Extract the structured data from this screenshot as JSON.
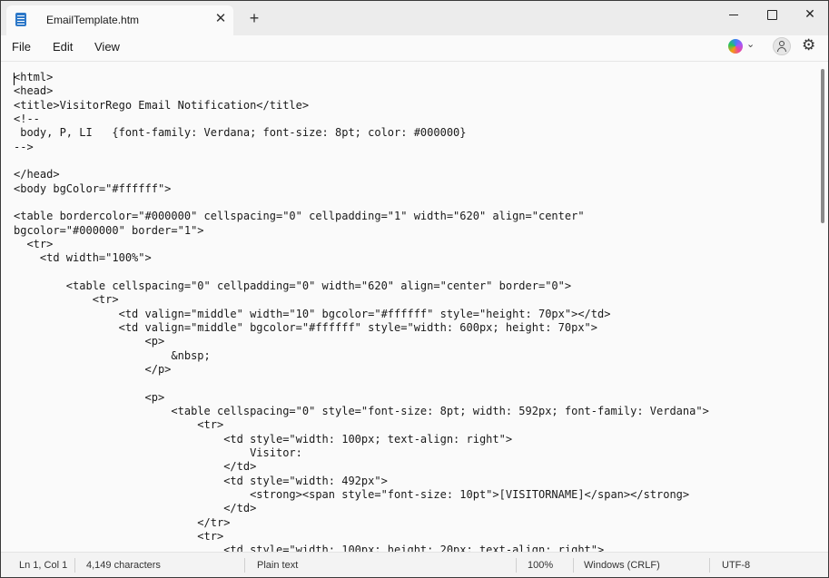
{
  "tab": {
    "title": "EmailTemplate.htm"
  },
  "menu": {
    "file": "File",
    "edit": "Edit",
    "view": "View"
  },
  "code_lines": [
    "<html>",
    "<head>",
    "<title>VisitorRego Email Notification</title>",
    "<!--",
    " body, P, LI   {font-family: Verdana; font-size: 8pt; color: #000000}",
    "-->",
    "",
    "</head>",
    "<body bgColor=\"#ffffff\">",
    "",
    "<table bordercolor=\"#000000\" cellspacing=\"0\" cellpadding=\"1\" width=\"620\" align=\"center\"",
    "bgcolor=\"#000000\" border=\"1\">",
    "  <tr>",
    "    <td width=\"100%\">",
    "",
    "        <table cellspacing=\"0\" cellpadding=\"0\" width=\"620\" align=\"center\" border=\"0\">",
    "            <tr>",
    "                <td valign=\"middle\" width=\"10\" bgcolor=\"#ffffff\" style=\"height: 70px\"></td>",
    "                <td valign=\"middle\" bgcolor=\"#ffffff\" style=\"width: 600px; height: 70px\">",
    "                    <p>",
    "                        &nbsp;",
    "                    </p>",
    "",
    "                    <p>",
    "                        <table cellspacing=\"0\" style=\"font-size: 8pt; width: 592px; font-family: Verdana\">",
    "                            <tr>",
    "                                <td style=\"width: 100px; text-align: right\">",
    "                                    Visitor:",
    "                                </td>",
    "                                <td style=\"width: 492px\">",
    "                                    <strong><span style=\"font-size: 10pt\">[VISITORNAME]</span></strong>",
    "                                </td>",
    "                            </tr>",
    "                            <tr>",
    "                                <td style=\"width: 100px; height: 20px; text-align: right\">"
  ],
  "status": {
    "position": "Ln 1, Col 1",
    "characters": "4,149 characters",
    "file_type": "Plain text",
    "zoom": "100%",
    "line_ending": "Windows (CRLF)",
    "encoding": "UTF-8"
  },
  "icons": {
    "app": "notepad-icon",
    "close_tab": "close-icon",
    "new_tab": "plus-icon",
    "copilot": "copilot-icon",
    "account": "account-icon",
    "settings": "gear-icon"
  }
}
